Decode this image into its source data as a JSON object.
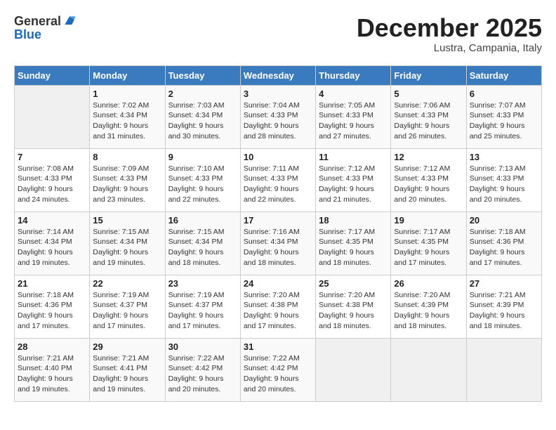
{
  "header": {
    "logo_general": "General",
    "logo_blue": "Blue",
    "month": "December 2025",
    "location": "Lustra, Campania, Italy"
  },
  "days_of_week": [
    "Sunday",
    "Monday",
    "Tuesday",
    "Wednesday",
    "Thursday",
    "Friday",
    "Saturday"
  ],
  "weeks": [
    [
      {
        "day": "",
        "sunrise": "",
        "sunset": "",
        "daylight": "",
        "empty": true
      },
      {
        "day": "1",
        "sunrise": "Sunrise: 7:02 AM",
        "sunset": "Sunset: 4:34 PM",
        "daylight": "Daylight: 9 hours and 31 minutes."
      },
      {
        "day": "2",
        "sunrise": "Sunrise: 7:03 AM",
        "sunset": "Sunset: 4:34 PM",
        "daylight": "Daylight: 9 hours and 30 minutes."
      },
      {
        "day": "3",
        "sunrise": "Sunrise: 7:04 AM",
        "sunset": "Sunset: 4:33 PM",
        "daylight": "Daylight: 9 hours and 28 minutes."
      },
      {
        "day": "4",
        "sunrise": "Sunrise: 7:05 AM",
        "sunset": "Sunset: 4:33 PM",
        "daylight": "Daylight: 9 hours and 27 minutes."
      },
      {
        "day": "5",
        "sunrise": "Sunrise: 7:06 AM",
        "sunset": "Sunset: 4:33 PM",
        "daylight": "Daylight: 9 hours and 26 minutes."
      },
      {
        "day": "6",
        "sunrise": "Sunrise: 7:07 AM",
        "sunset": "Sunset: 4:33 PM",
        "daylight": "Daylight: 9 hours and 25 minutes."
      }
    ],
    [
      {
        "day": "7",
        "sunrise": "Sunrise: 7:08 AM",
        "sunset": "Sunset: 4:33 PM",
        "daylight": "Daylight: 9 hours and 24 minutes."
      },
      {
        "day": "8",
        "sunrise": "Sunrise: 7:09 AM",
        "sunset": "Sunset: 4:33 PM",
        "daylight": "Daylight: 9 hours and 23 minutes."
      },
      {
        "day": "9",
        "sunrise": "Sunrise: 7:10 AM",
        "sunset": "Sunset: 4:33 PM",
        "daylight": "Daylight: 9 hours and 22 minutes."
      },
      {
        "day": "10",
        "sunrise": "Sunrise: 7:11 AM",
        "sunset": "Sunset: 4:33 PM",
        "daylight": "Daylight: 9 hours and 22 minutes."
      },
      {
        "day": "11",
        "sunrise": "Sunrise: 7:12 AM",
        "sunset": "Sunset: 4:33 PM",
        "daylight": "Daylight: 9 hours and 21 minutes."
      },
      {
        "day": "12",
        "sunrise": "Sunrise: 7:12 AM",
        "sunset": "Sunset: 4:33 PM",
        "daylight": "Daylight: 9 hours and 20 minutes."
      },
      {
        "day": "13",
        "sunrise": "Sunrise: 7:13 AM",
        "sunset": "Sunset: 4:33 PM",
        "daylight": "Daylight: 9 hours and 20 minutes."
      }
    ],
    [
      {
        "day": "14",
        "sunrise": "Sunrise: 7:14 AM",
        "sunset": "Sunset: 4:34 PM",
        "daylight": "Daylight: 9 hours and 19 minutes."
      },
      {
        "day": "15",
        "sunrise": "Sunrise: 7:15 AM",
        "sunset": "Sunset: 4:34 PM",
        "daylight": "Daylight: 9 hours and 19 minutes."
      },
      {
        "day": "16",
        "sunrise": "Sunrise: 7:15 AM",
        "sunset": "Sunset: 4:34 PM",
        "daylight": "Daylight: 9 hours and 18 minutes."
      },
      {
        "day": "17",
        "sunrise": "Sunrise: 7:16 AM",
        "sunset": "Sunset: 4:34 PM",
        "daylight": "Daylight: 9 hours and 18 minutes."
      },
      {
        "day": "18",
        "sunrise": "Sunrise: 7:17 AM",
        "sunset": "Sunset: 4:35 PM",
        "daylight": "Daylight: 9 hours and 18 minutes."
      },
      {
        "day": "19",
        "sunrise": "Sunrise: 7:17 AM",
        "sunset": "Sunset: 4:35 PM",
        "daylight": "Daylight: 9 hours and 17 minutes."
      },
      {
        "day": "20",
        "sunrise": "Sunrise: 7:18 AM",
        "sunset": "Sunset: 4:36 PM",
        "daylight": "Daylight: 9 hours and 17 minutes."
      }
    ],
    [
      {
        "day": "21",
        "sunrise": "Sunrise: 7:18 AM",
        "sunset": "Sunset: 4:36 PM",
        "daylight": "Daylight: 9 hours and 17 minutes."
      },
      {
        "day": "22",
        "sunrise": "Sunrise: 7:19 AM",
        "sunset": "Sunset: 4:37 PM",
        "daylight": "Daylight: 9 hours and 17 minutes."
      },
      {
        "day": "23",
        "sunrise": "Sunrise: 7:19 AM",
        "sunset": "Sunset: 4:37 PM",
        "daylight": "Daylight: 9 hours and 17 minutes."
      },
      {
        "day": "24",
        "sunrise": "Sunrise: 7:20 AM",
        "sunset": "Sunset: 4:38 PM",
        "daylight": "Daylight: 9 hours and 17 minutes."
      },
      {
        "day": "25",
        "sunrise": "Sunrise: 7:20 AM",
        "sunset": "Sunset: 4:38 PM",
        "daylight": "Daylight: 9 hours and 18 minutes."
      },
      {
        "day": "26",
        "sunrise": "Sunrise: 7:20 AM",
        "sunset": "Sunset: 4:39 PM",
        "daylight": "Daylight: 9 hours and 18 minutes."
      },
      {
        "day": "27",
        "sunrise": "Sunrise: 7:21 AM",
        "sunset": "Sunset: 4:39 PM",
        "daylight": "Daylight: 9 hours and 18 minutes."
      }
    ],
    [
      {
        "day": "28",
        "sunrise": "Sunrise: 7:21 AM",
        "sunset": "Sunset: 4:40 PM",
        "daylight": "Daylight: 9 hours and 19 minutes."
      },
      {
        "day": "29",
        "sunrise": "Sunrise: 7:21 AM",
        "sunset": "Sunset: 4:41 PM",
        "daylight": "Daylight: 9 hours and 19 minutes."
      },
      {
        "day": "30",
        "sunrise": "Sunrise: 7:22 AM",
        "sunset": "Sunset: 4:42 PM",
        "daylight": "Daylight: 9 hours and 20 minutes."
      },
      {
        "day": "31",
        "sunrise": "Sunrise: 7:22 AM",
        "sunset": "Sunset: 4:42 PM",
        "daylight": "Daylight: 9 hours and 20 minutes."
      },
      {
        "day": "",
        "sunrise": "",
        "sunset": "",
        "daylight": "",
        "empty": true
      },
      {
        "day": "",
        "sunrise": "",
        "sunset": "",
        "daylight": "",
        "empty": true
      },
      {
        "day": "",
        "sunrise": "",
        "sunset": "",
        "daylight": "",
        "empty": true
      }
    ]
  ]
}
